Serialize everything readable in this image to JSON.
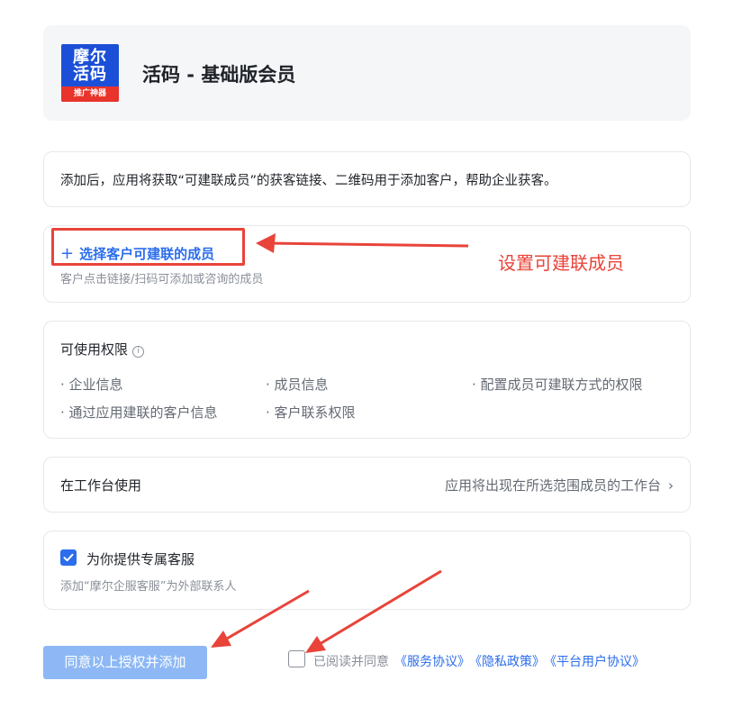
{
  "header": {
    "logo_line1": "摩尔",
    "logo_line2": "活码",
    "logo_band": "推广神器",
    "app_title": "活码 - 基础版会员"
  },
  "description": "添加后，应用将获取“可建联成员”的获客链接、二维码用于添加客户，帮助企业获客。",
  "members": {
    "add_label": "选择客户可建联的成员",
    "add_icon": "plus-icon",
    "subtext": "客户点击链接/扫码可添加或咨询的成员"
  },
  "permissions": {
    "title": "可使用权限",
    "info_icon": "info-icon",
    "items": [
      "企业信息",
      "成员信息",
      "配置成员可建联方式的权限",
      "通过应用建联的客户信息",
      "客户联系权限"
    ]
  },
  "workbench": {
    "label": "在工作台使用",
    "value": "应用将出现在所选范围成员的工作台",
    "chevron": "›"
  },
  "service": {
    "checked": true,
    "title": "为你提供专属客服",
    "subtext": "添加“摩尔企服客服”为外部联系人"
  },
  "footer": {
    "submit_label": "同意以上授权并添加",
    "agree_checked": false,
    "agree_text": "已阅读并同意",
    "links": [
      "《服务协议》",
      "《隐私政策》",
      "《平台用户协议》"
    ]
  },
  "annotation": {
    "label": "设置可建联成员",
    "color": "#e8443a"
  },
  "colors": {
    "accent": "#2b6dec",
    "button_disabled": "#8db8f5",
    "annotation_red": "#e8443a"
  }
}
